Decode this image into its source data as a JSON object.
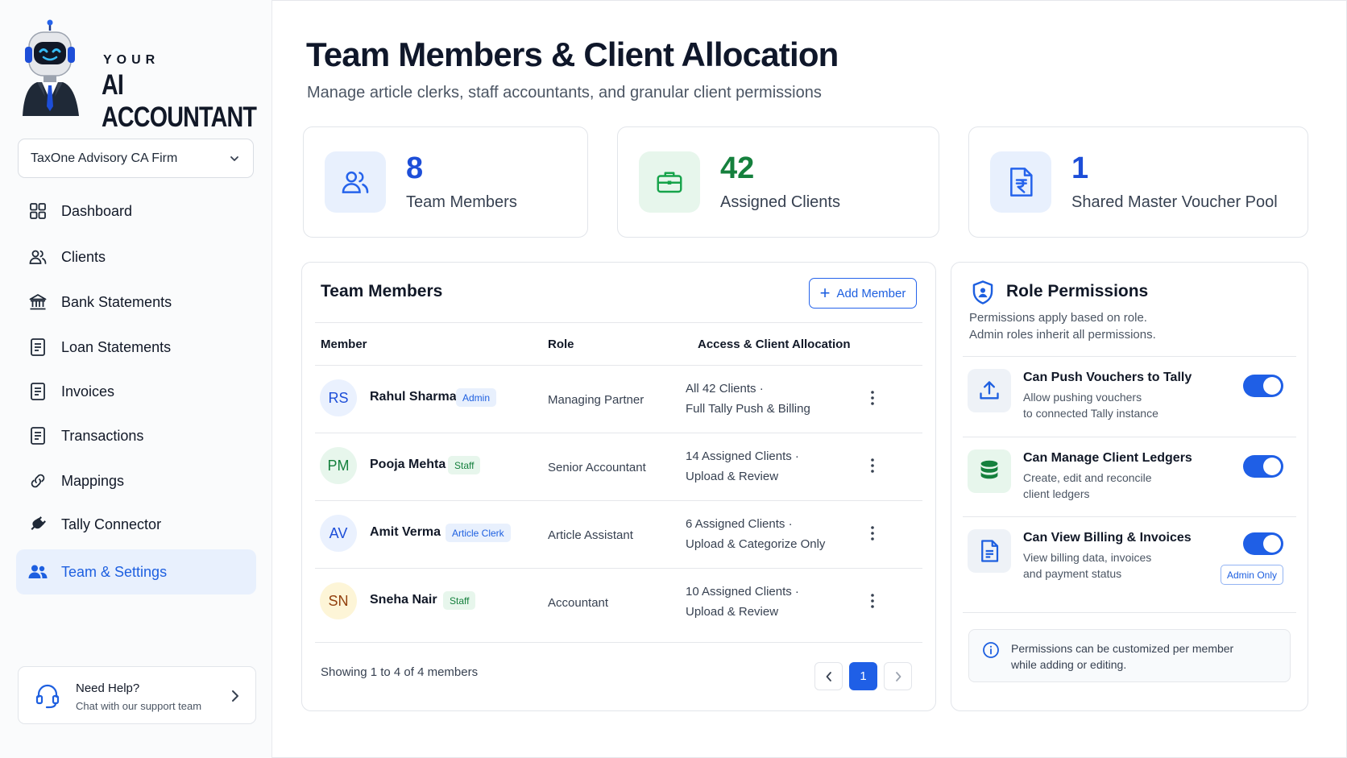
{
  "brand": {
    "line1": "YOUR",
    "line2": "AI ACCOUNTANT"
  },
  "firm_select": {
    "value": "TaxOne Advisory CA Firm"
  },
  "nav": [
    {
      "label": "Dashboard",
      "icon": "grid-icon"
    },
    {
      "label": "Clients",
      "icon": "users-icon"
    },
    {
      "label": "Bank Statements",
      "icon": "bank-icon"
    },
    {
      "label": "Loan Statements",
      "icon": "document-icon"
    },
    {
      "label": "Invoices",
      "icon": "document-icon"
    },
    {
      "label": "Transactions",
      "icon": "document-icon"
    },
    {
      "label": "Mappings",
      "icon": "link-icon"
    },
    {
      "label": "Tally Connector",
      "icon": "plug-icon"
    },
    {
      "label": "Team & Settings",
      "icon": "team-icon",
      "active": true
    }
  ],
  "help": {
    "title": "Need Help?",
    "subtitle": "Chat with our support team"
  },
  "header": {
    "title": "Team Members & Client Allocation",
    "subtitle": "Manage article clerks, staff accountants, and granular client permissions"
  },
  "stats": [
    {
      "value": "8",
      "label": "Team Members",
      "color": "#1d4ed8",
      "icon": "users-icon"
    },
    {
      "value": "42",
      "label": "Assigned Clients",
      "color": "#15803d",
      "icon": "briefcase-icon"
    },
    {
      "value": "1",
      "label": "Shared Master Voucher Pool",
      "color": "#1d4ed8",
      "icon": "rupee-document-icon"
    }
  ],
  "team": {
    "title": "Team Members",
    "add_label": "Add Member",
    "columns": [
      "Member",
      "Role",
      "Access & Client Allocation"
    ],
    "rows": [
      {
        "initials": "RS",
        "name": "Rahul Sharma",
        "badge": "Admin",
        "role": "Managing Partner",
        "access1": "All 42 Clients ·",
        "access2": "Full Tally Push & Billing"
      },
      {
        "initials": "PM",
        "name": "Pooja Mehta",
        "badge": "Staff",
        "role": "Senior Accountant",
        "access1": "14 Assigned Clients ·",
        "access2": "Upload & Review"
      },
      {
        "initials": "AV",
        "name": "Amit Verma",
        "badge": "Article Clerk",
        "role": "Article Assistant",
        "access1": "6 Assigned Clients ·",
        "access2": "Upload & Categorize Only"
      },
      {
        "initials": "SN",
        "name": "Sneha Nair",
        "badge": "Staff",
        "role": "Accountant",
        "access1": "10 Assigned Clients ·",
        "access2": "Upload & Review"
      }
    ],
    "showing": "Showing 1 to 4 of 4 members",
    "page": "1"
  },
  "permissions": {
    "title": "Role Permissions",
    "desc1": "Permissions apply based on role.",
    "desc2": "Admin roles inherit all permissions.",
    "items": [
      {
        "title": "Can Push Vouchers to Tally",
        "d1": "Allow pushing vouchers",
        "d2": "to connected Tally instance",
        "icon": "upload-icon",
        "enabled": true
      },
      {
        "title": "Can Manage Client Ledgers",
        "d1": "Create, edit and reconcile",
        "d2": "client ledgers",
        "icon": "database-icon",
        "enabled": true
      },
      {
        "title": "Can View Billing & Invoices",
        "d1": "View billing data, invoices",
        "d2": "and payment status",
        "icon": "invoice-icon",
        "enabled": true,
        "tag": "Admin Only"
      }
    ],
    "note1": "Permissions can be customized per member",
    "note2": "while adding or editing."
  }
}
